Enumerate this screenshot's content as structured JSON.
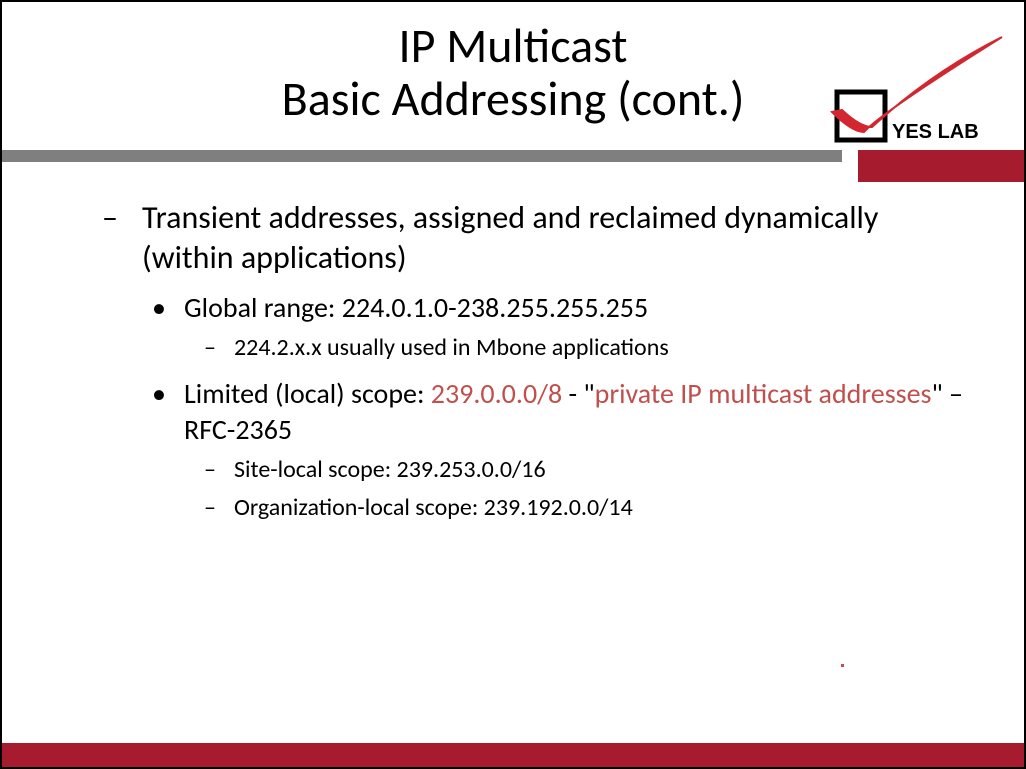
{
  "title": {
    "line1": "IP Multicast",
    "line2": "Basic Addressing (cont.)"
  },
  "logo": {
    "text": "YES LAB"
  },
  "content": {
    "main": "Transient addresses, assigned and reclaimed dynamically (within applications)",
    "sub1": {
      "text": "Global range: 224.0.1.0-238.255.255.255",
      "sub": "224.2.x.x usually used in Mbone applications"
    },
    "sub2": {
      "pre": "Limited (local) scope: ",
      "hl1": "239.0.0.0/8",
      "mid": " - \"",
      "hl2": "private IP multicast addresses",
      "post": "\" – RFC-2365",
      "sub1": "Site-local scope: 239.253.0.0/16",
      "sub2": "Organization-local scope: 239.192.0.0/14"
    }
  }
}
